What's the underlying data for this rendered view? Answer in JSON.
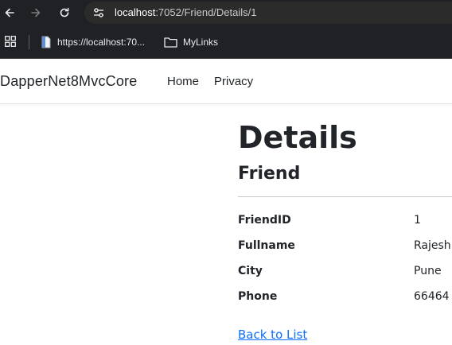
{
  "browser": {
    "url_host": "localhost",
    "url_path": ":7052/Friend/Details/1",
    "bookmarks": [
      {
        "label": "https://localhost:70...",
        "icon": "page-icon"
      },
      {
        "label": "MyLinks",
        "icon": "folder-icon"
      }
    ]
  },
  "navbar": {
    "brand": "DapperNet8MvcCore",
    "links": [
      "Home",
      "Privacy"
    ]
  },
  "page": {
    "title": "Details",
    "subtitle": "Friend",
    "fields": [
      {
        "label": "FriendID",
        "value": "1"
      },
      {
        "label": "Fullname",
        "value": "Rajesh"
      },
      {
        "label": "City",
        "value": "Pune"
      },
      {
        "label": "Phone",
        "value": "66464"
      }
    ],
    "back_link": "Back to List"
  },
  "colors": {
    "chrome": "#202124",
    "link": "#0d6efd",
    "text": "#212529"
  }
}
